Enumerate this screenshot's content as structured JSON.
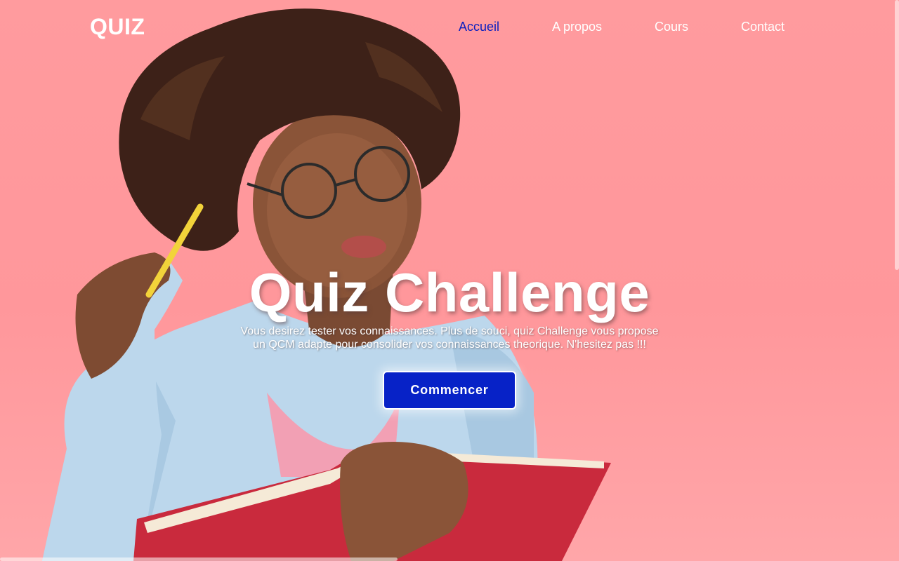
{
  "nav": {
    "logo": "QUIZ",
    "links": [
      {
        "label": "Accueil",
        "active": true
      },
      {
        "label": "A propos",
        "active": false
      },
      {
        "label": "Cours",
        "active": false
      },
      {
        "label": "Contact",
        "active": false
      }
    ]
  },
  "hero": {
    "title": "Quiz Challenge",
    "subtitle_line1": "Vous desirez tester vos connaissances. Plus de souci, quiz Challenge vous propose",
    "subtitle_line2": "un QCM adapte pour consolider vos connaissances theorique. N'hesitez pas !!!",
    "button_label": "Commencer"
  },
  "colors": {
    "background": "#ff9b9e",
    "active_link": "#0a1fc0",
    "button": "#0722c7",
    "text": "#ffffff"
  }
}
